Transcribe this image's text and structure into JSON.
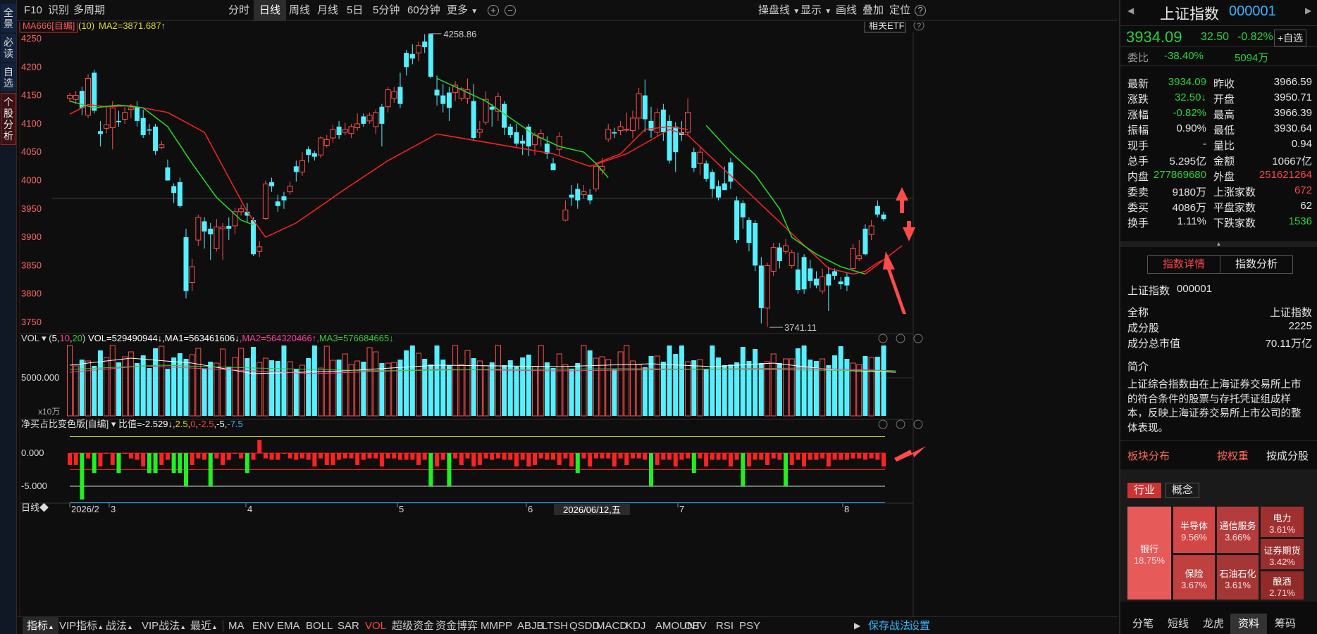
{
  "left_sidebar": [
    "全景",
    "必读",
    "自选",
    "个股分析"
  ],
  "topbar": {
    "left": [
      "F10",
      "识别",
      "多周期"
    ],
    "periods": [
      "分时",
      "日线",
      "周线",
      "月线",
      "5日",
      "5分钟",
      "60分钟",
      "更多"
    ],
    "active_period": "日线",
    "right": [
      "操盘线",
      "显示",
      "画线",
      "叠加",
      "定位"
    ]
  },
  "main_header": {
    "ma_name": "MA666[自编]",
    "ma_param": "(10)",
    "ma2": "MA2=3871.687↑",
    "etf_button": "相关ETF"
  },
  "main_y_ticks": [
    "4250",
    "4200",
    "4150",
    "4100",
    "4050",
    "4000",
    "3950",
    "3900",
    "3850",
    "3800",
    "3750"
  ],
  "price_annotations": {
    "high": "4258.86",
    "low": "3741.11"
  },
  "vol_header": {
    "name": "VOL",
    "params": [
      "(",
      "5",
      ",",
      "10",
      ",",
      "20",
      ")"
    ],
    "vol": "VOL=529490944↓",
    "ma1": ",MA1=563461606↓",
    "ma2": ",MA2=564320466↑",
    "ma3": ",MA3=576684665↓"
  },
  "vol_y": [
    "5000.000"
  ],
  "vol_unit": "x10万",
  "ind_header": {
    "name": "净买占比变色版[自编]",
    "label": "比值=",
    "value": "-2.529↓",
    "v1": "2.5",
    "v2": "0",
    "v3": "-2.5",
    "v4": "-5",
    "v5": "-7.5"
  },
  "ind_y": [
    "0.000",
    "-5.000"
  ],
  "x_axis": {
    "period_label": "日线◆",
    "labels": [
      "2026/2",
      "3",
      "4",
      "5",
      "6",
      "7",
      "8"
    ],
    "cursor_date": "2026/06/12,五"
  },
  "bottombar": {
    "items": [
      "指标",
      "VIP指标",
      "战法",
      "VIP战法",
      "最近"
    ],
    "indicators": [
      "MA",
      "ENV",
      "EMA",
      "BOLL",
      "SAR",
      "VOL",
      "超级资金",
      "资金博弈",
      "MMPP",
      "ABJB",
      "LTSH",
      "QSDD",
      "MACD",
      "KDJ",
      "AMOUNT",
      "OBV",
      "RSI",
      "PSY"
    ],
    "active_indicator": "VOL",
    "right": [
      "保存战法",
      "设置"
    ]
  },
  "right_panel": {
    "title": "上证指数",
    "code": "000001",
    "price": "3934.09",
    "change": "32.50",
    "change_pct": "-0.82%",
    "watch_button": "+自选",
    "weibi_label": "委比",
    "weibi_value": "-38.40%",
    "weicha_value": "5094万",
    "quote_rows": [
      [
        "最新",
        "3934.09",
        "昨收",
        "3966.59"
      ],
      [
        "涨跌",
        "32.50↓",
        "开盘",
        "3950.71"
      ],
      [
        "涨幅",
        "-0.82%",
        "最高",
        "3966.39"
      ],
      [
        "振幅",
        "0.90%",
        "最低",
        "3930.64"
      ],
      [
        "现手",
        "-",
        "量比",
        "0.94"
      ],
      [
        "总手",
        "5.295亿",
        "金额",
        "10667亿"
      ],
      [
        "内盘",
        "277869680",
        "外盘",
        "251621264"
      ],
      [
        "委卖",
        "9180万",
        "上涨家数",
        "672"
      ],
      [
        "委买",
        "4086万",
        "平盘家数",
        "62"
      ],
      [
        "换手",
        "1.11%",
        "下跌家数",
        "1536"
      ]
    ],
    "tabs": [
      "指数详情",
      "指数分析"
    ],
    "info_title": "上证指数",
    "info_code": "000001",
    "info_rows": [
      [
        "全称",
        "上证指数"
      ],
      [
        "成分股",
        "2225"
      ],
      [
        "成分总市值",
        "70.11万亿"
      ]
    ],
    "intro_label": "简介",
    "intro_lines": [
      "上证综合指数由在上海证券交易所上市",
      "的符合条件的股票与存托凭证组成样",
      "本，反映上海证券交易所上市公司的整",
      "体表现。"
    ],
    "block_label": "板块分布",
    "block_tabs": [
      "按权重",
      "按成分股"
    ],
    "cat_buttons": [
      "行业",
      "概念"
    ],
    "tiles": [
      [
        "银行",
        "18.75%"
      ],
      [
        "半导体",
        "9.56%"
      ],
      [
        "通信服务",
        "3.66%"
      ],
      [
        "电力",
        "3.61%"
      ],
      [
        "证券期货",
        "3.42%"
      ],
      [
        "保险",
        "3.67%"
      ],
      [
        "石油石化",
        "3.61%"
      ],
      [
        "酿酒",
        "2.71%"
      ]
    ],
    "bottom_tabs": [
      "分笔",
      "短线",
      "龙虎",
      "资料",
      "筹码"
    ],
    "active_bottom_tab": "资料"
  },
  "colors": {
    "up": "#ff4d4d",
    "down": "#54f0ff",
    "ma_red": "#ff2222",
    "ma_green": "#22dd22",
    "accent_red": "#ff4545",
    "accent_green": "#22d63c",
    "accent_blue": "#35b6ff"
  },
  "chart_data": {
    "type": "candlestick",
    "ylim": [
      3730,
      4265
    ],
    "candles": [
      [
        4145,
        4150,
        4155,
        4138
      ],
      [
        4143,
        4150,
        4158,
        4135
      ],
      [
        4158,
        4128,
        4165,
        4115
      ],
      [
        4115,
        4180,
        4188,
        4110
      ],
      [
        4190,
        4123,
        4195,
        4118
      ],
      [
        4087,
        4082,
        4105,
        4060
      ],
      [
        4092,
        4098,
        4130,
        4083
      ],
      [
        4093,
        4128,
        4140,
        4055
      ],
      [
        4105,
        4103,
        4123,
        4095
      ],
      [
        4108,
        4120,
        4130,
        4100
      ],
      [
        4125,
        4128,
        4135,
        4110
      ],
      [
        4130,
        4105,
        4140,
        4095
      ],
      [
        4110,
        4080,
        4125,
        4075
      ],
      [
        4090,
        4088,
        4100,
        4080
      ],
      [
        4095,
        4052,
        4100,
        4045
      ],
      [
        4058,
        4063,
        4070,
        4055
      ],
      [
        4023,
        4000,
        4037,
        4000
      ],
      [
        3990,
        3978,
        3995,
        3960
      ],
      [
        3997,
        3955,
        4005,
        3952
      ],
      [
        3900,
        3805,
        3915,
        3792
      ],
      [
        3820,
        3848,
        3862,
        3805
      ],
      [
        3895,
        3935,
        3940,
        3885
      ],
      [
        3928,
        3910,
        3935,
        3880
      ],
      [
        3915,
        3905,
        3925,
        3860
      ],
      [
        3880,
        3918,
        3932,
        3875
      ],
      [
        3915,
        3918,
        3925,
        3860
      ],
      [
        3920,
        3915,
        3935,
        3895
      ],
      [
        3920,
        3945,
        3952,
        3905
      ],
      [
        3945,
        3950,
        3957,
        3938
      ],
      [
        3945,
        3938,
        3960,
        3926
      ],
      [
        3930,
        3870,
        3935,
        3867
      ],
      [
        3875,
        3883,
        3893,
        3865
      ],
      [
        3933,
        3994,
        4000,
        3930
      ],
      [
        3997,
        3990,
        4005,
        3980
      ],
      [
        3963,
        3955,
        3975,
        3945
      ],
      [
        3972,
        3965,
        3980,
        3950
      ],
      [
        3980,
        3990,
        3998,
        3975
      ],
      [
        4025,
        4015,
        4035,
        3998
      ],
      [
        4015,
        4035,
        4050,
        4008
      ],
      [
        4055,
        4045,
        4060,
        4032
      ],
      [
        4048,
        4042,
        4052,
        4035
      ],
      [
        4045,
        4075,
        4078,
        4040
      ],
      [
        4062,
        4072,
        4080,
        4058
      ],
      [
        4075,
        4090,
        4098,
        4067
      ],
      [
        4095,
        4080,
        4105,
        4073
      ],
      [
        4085,
        4090,
        4102,
        4080
      ],
      [
        4083,
        4095,
        4100,
        4075
      ],
      [
        4093,
        4100,
        4118,
        4088
      ],
      [
        4113,
        4100,
        4118,
        4095
      ],
      [
        4105,
        4115,
        4120,
        4100
      ],
      [
        4095,
        4120,
        4125,
        4082
      ],
      [
        4130,
        4100,
        4135,
        4060
      ],
      [
        4130,
        4160,
        4165,
        4120
      ],
      [
        4145,
        4157,
        4165,
        4137
      ],
      [
        4165,
        4135,
        4190,
        4128
      ],
      [
        4225,
        4200,
        4230,
        4185
      ],
      [
        4223,
        4215,
        4240,
        4205
      ],
      [
        4225,
        4238,
        4245,
        4210
      ],
      [
        4245,
        4235,
        4258,
        4225
      ],
      [
        4258,
        4183,
        4259,
        4180
      ],
      [
        4160,
        4150,
        4185,
        4132
      ],
      [
        4150,
        4135,
        4170,
        4120
      ],
      [
        4155,
        4128,
        4165,
        4105
      ],
      [
        4155,
        4168,
        4175,
        4140
      ],
      [
        4145,
        4162,
        4165,
        4140
      ],
      [
        4145,
        4160,
        4180,
        4135
      ],
      [
        4140,
        4075,
        4170,
        4070
      ],
      [
        4085,
        4090,
        4105,
        4075
      ],
      [
        4103,
        4143,
        4157,
        4098
      ],
      [
        4130,
        4125,
        4135,
        4095
      ],
      [
        4122,
        4148,
        4155,
        4105
      ],
      [
        4135,
        4093,
        4140,
        4080
      ],
      [
        4095,
        4080,
        4100,
        4075
      ],
      [
        4085,
        4065,
        4100,
        4060
      ],
      [
        4070,
        4065,
        4080,
        4045
      ],
      [
        4095,
        4060,
        4100,
        4043
      ],
      [
        4063,
        4080,
        4085,
        4045
      ],
      [
        4075,
        4083,
        4090,
        4060
      ],
      [
        4065,
        4047,
        4078,
        4038
      ],
      [
        4030,
        4018,
        4040,
        4020
      ],
      [
        4055,
        4078,
        4085,
        4045
      ],
      [
        3930,
        3948,
        3965,
        3928
      ],
      [
        3975,
        3970,
        3992,
        3955
      ],
      [
        3985,
        3965,
        3995,
        3950
      ],
      [
        3975,
        3980,
        3992,
        3968
      ],
      [
        3975,
        3965,
        3985,
        3958
      ],
      [
        3985,
        4025,
        4032,
        3980
      ],
      [
        4018,
        4025,
        4040,
        4010
      ],
      [
        4073,
        4090,
        4100,
        4068
      ],
      [
        4085,
        4083,
        4093,
        4075
      ],
      [
        4088,
        4095,
        4105,
        4080
      ],
      [
        4090,
        4090,
        4120,
        4085
      ],
      [
        4088,
        4110,
        4123,
        4075
      ],
      [
        4110,
        4153,
        4163,
        4090
      ],
      [
        4150,
        4108,
        4178,
        4085
      ],
      [
        4105,
        4088,
        4130,
        4075
      ],
      [
        4085,
        4120,
        4127,
        4078
      ],
      [
        4125,
        4085,
        4135,
        4070
      ],
      [
        4105,
        4035,
        4115,
        4030
      ],
      [
        4095,
        4050,
        4103,
        4015
      ],
      [
        4085,
        4080,
        4105,
        4070
      ],
      [
        4085,
        4120,
        4145,
        4080
      ],
      [
        4050,
        4022,
        4058,
        4015
      ],
      [
        4030,
        4050,
        4060,
        4010
      ],
      [
        4030,
        4003,
        4035,
        3998
      ],
      [
        4015,
        3985,
        4020,
        3970
      ],
      [
        3990,
        3970,
        4000,
        3965
      ],
      [
        3995,
        3983,
        4025,
        3983
      ],
      [
        4032,
        3998,
        4040,
        3985
      ],
      [
        3965,
        3895,
        3972,
        3890
      ],
      [
        3960,
        3935,
        3965,
        3915
      ],
      [
        3930,
        3890,
        3935,
        3875
      ],
      [
        3925,
        3850,
        3930,
        3840
      ],
      [
        3850,
        3775,
        3865,
        3748
      ],
      [
        3775,
        3850,
        3855,
        3742
      ],
      [
        3840,
        3882,
        3890,
        3832
      ],
      [
        3882,
        3858,
        3890,
        3845
      ],
      [
        3875,
        3885,
        3897,
        3870
      ],
      [
        3850,
        3873,
        3878,
        3845
      ],
      [
        3843,
        3807,
        3873,
        3800
      ],
      [
        3865,
        3808,
        3870,
        3800
      ],
      [
        3845,
        3823,
        3860,
        3810
      ],
      [
        3827,
        3815,
        3840,
        3810
      ],
      [
        3805,
        3830,
        3845,
        3800
      ],
      [
        3835,
        3815,
        3848,
        3770
      ],
      [
        3840,
        3832,
        3845,
        3825
      ],
      [
        3822,
        3817,
        3830,
        3808
      ],
      [
        3830,
        3815,
        3838,
        3805
      ],
      [
        3845,
        3880,
        3888,
        3843
      ],
      [
        3862,
        3867,
        3895,
        3858
      ],
      [
        3915,
        3870,
        3923,
        3868
      ],
      [
        3905,
        3920,
        3930,
        3895
      ],
      [
        3955,
        3940,
        3965,
        3935
      ],
      [
        3940,
        3932,
        3945,
        3928
      ]
    ],
    "ma_red_breaks": [
      [
        0,
        4117
      ],
      [
        3,
        4134
      ],
      [
        6,
        4130
      ],
      [
        10,
        4132
      ],
      [
        16,
        4120
      ],
      [
        22,
        4085
      ],
      [
        29,
        3945
      ],
      [
        32,
        3900
      ],
      [
        37,
        3925
      ],
      [
        45,
        3985
      ],
      [
        52,
        4035
      ],
      [
        60,
        4082
      ],
      [
        65,
        4078
      ],
      [
        70,
        4092
      ],
      [
        79,
        4047
      ],
      [
        85,
        4025
      ],
      [
        91,
        4047
      ],
      [
        98,
        4090
      ],
      [
        101,
        4080
      ],
      [
        105,
        4030
      ],
      [
        110,
        3960
      ],
      [
        112,
        3905
      ],
      [
        116,
        3880
      ],
      [
        120,
        3860
      ],
      [
        124,
        3845
      ],
      [
        128,
        3835
      ],
      [
        130,
        3840
      ],
      [
        132,
        3855
      ],
      [
        133,
        3860
      ]
    ],
    "ma_green": [
      [
        0,
        4140
      ],
      [
        4,
        4128
      ],
      [
        7,
        4132
      ],
      [
        12,
        4128
      ],
      [
        16,
        4098
      ],
      [
        20,
        4030
      ],
      [
        24,
        3968
      ],
      [
        28,
        3930
      ],
      [
        30,
        3920
      ],
      [
        32,
        3930
      ]
    ],
    "vol_ratio": [
      -2,
      -2,
      -7,
      -1,
      -3,
      -2,
      0,
      -2,
      -3,
      0,
      -1,
      -1,
      -2,
      -3,
      -3,
      -2,
      -1,
      -3,
      -3,
      -5,
      -2,
      -1,
      -1,
      -5,
      -1,
      -2,
      -1,
      0,
      -1,
      -3,
      -1,
      2,
      -1,
      -1,
      -1,
      0,
      -1,
      -1,
      -1,
      -1,
      -2,
      -1,
      -2,
      -2,
      -1,
      -1,
      -1,
      -2,
      -1,
      -1,
      -1,
      -2,
      -1,
      -1,
      -1,
      -1,
      -1,
      -2,
      -1,
      -5,
      -2,
      -1,
      -5,
      -1,
      -2,
      -1,
      -2,
      -2,
      -1,
      -1,
      -1,
      -1,
      -1,
      -2,
      -1,
      -2,
      -2,
      -1,
      -1,
      -1,
      -2,
      -1,
      -2,
      -3,
      -1,
      -2,
      -1,
      -1,
      -1,
      -2,
      -1,
      -2,
      -1,
      -1,
      -1,
      -5,
      -2,
      -1,
      -1,
      -2,
      -1,
      -1,
      -3,
      -1,
      -2,
      -1,
      -1,
      -1,
      -2,
      -1,
      -5,
      -2,
      -1,
      -1,
      -2,
      -1,
      -1,
      -5,
      -2,
      -1,
      -2,
      -1,
      -1,
      -1,
      -2,
      -1,
      -1,
      -1,
      -1,
      -1,
      -1,
      -1,
      -1,
      -2
    ]
  }
}
